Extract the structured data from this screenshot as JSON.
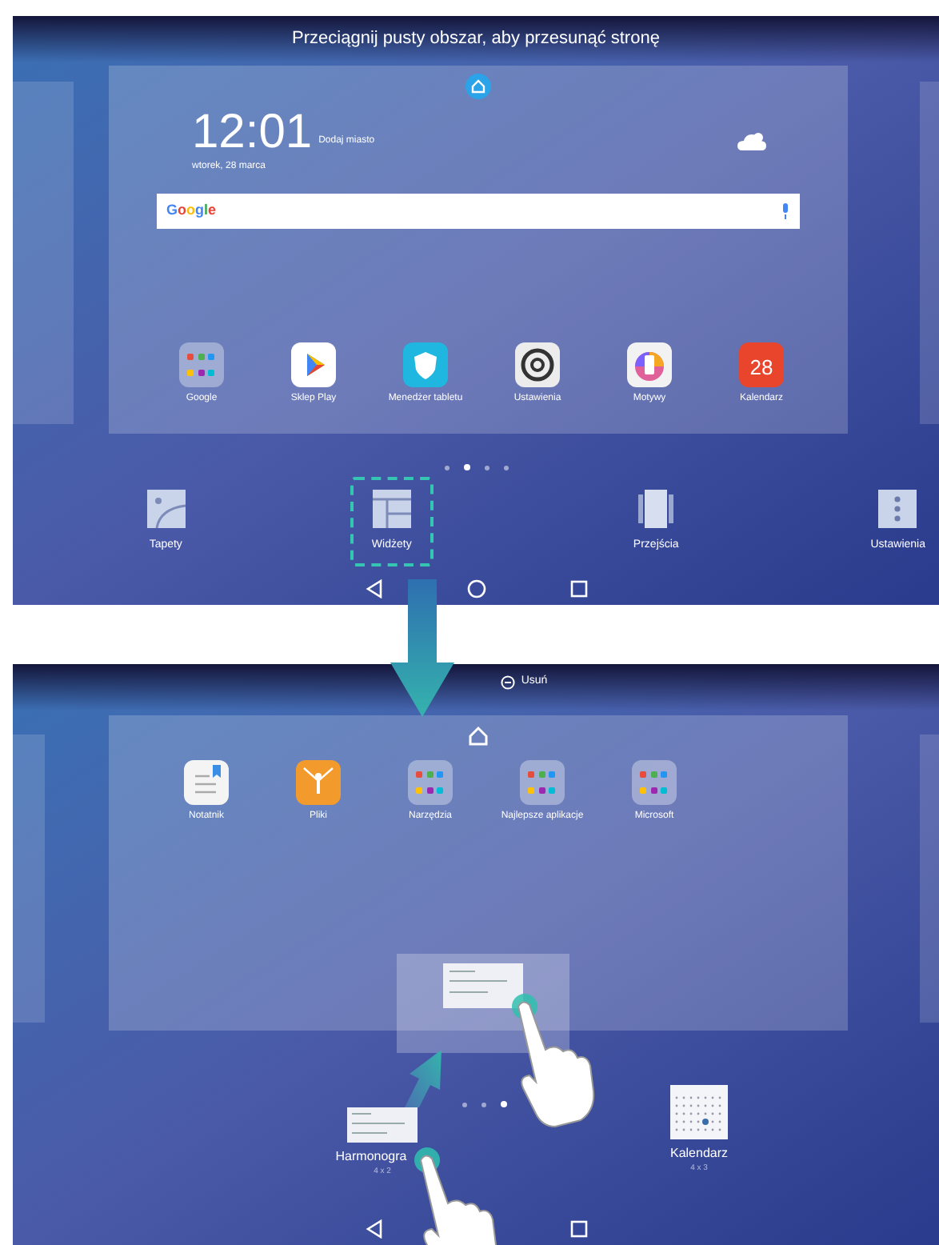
{
  "top_screen": {
    "hint": "Przeciągnij pusty obszar, aby przesunąć stronę",
    "clock": {
      "time": "12:01",
      "date": "wtorek, 28 marca",
      "city": "Dodaj miasto"
    },
    "search": {
      "logo": "Google"
    },
    "apps": [
      {
        "label": "Google",
        "kind": "folder"
      },
      {
        "label": "Sklep Play",
        "kind": "play"
      },
      {
        "label": "Menedżer tabletu",
        "kind": "shield"
      },
      {
        "label": "Ustawienia",
        "kind": "gear"
      },
      {
        "label": "Motywy",
        "kind": "brush"
      },
      {
        "label": "Kalendarz",
        "kind": "calendar",
        "badge": "28"
      }
    ],
    "page_dots": [
      {
        "selected": false
      },
      {
        "selected": true
      },
      {
        "selected": false
      },
      {
        "selected": false
      }
    ],
    "tools": [
      {
        "label": "Tapety",
        "kind": "wallpaper",
        "selected": false
      },
      {
        "label": "Widżety",
        "kind": "widgets",
        "selected": true
      },
      {
        "label": "Przejścia",
        "kind": "transitions",
        "selected": false
      },
      {
        "label": "Ustawienia",
        "kind": "settings",
        "selected": false
      }
    ]
  },
  "bottom_screen": {
    "remove": "Usuń",
    "apps": [
      {
        "label": "Notatnik",
        "kind": "notes"
      },
      {
        "label": "Pliki",
        "kind": "files"
      },
      {
        "label": "Narzędzia",
        "kind": "folder"
      },
      {
        "label": "Najlepsze aplikacje",
        "kind": "folder"
      },
      {
        "label": "Microsoft",
        "kind": "folder"
      }
    ],
    "page_dots": [
      {
        "selected": false
      },
      {
        "selected": false
      },
      {
        "selected": true
      }
    ],
    "widgets": [
      {
        "name": "Harmonogra",
        "size": "4 x 2",
        "kind": "schedule"
      },
      {
        "name": "Kalendarz",
        "size": "4 x 3",
        "kind": "calendar"
      }
    ]
  }
}
